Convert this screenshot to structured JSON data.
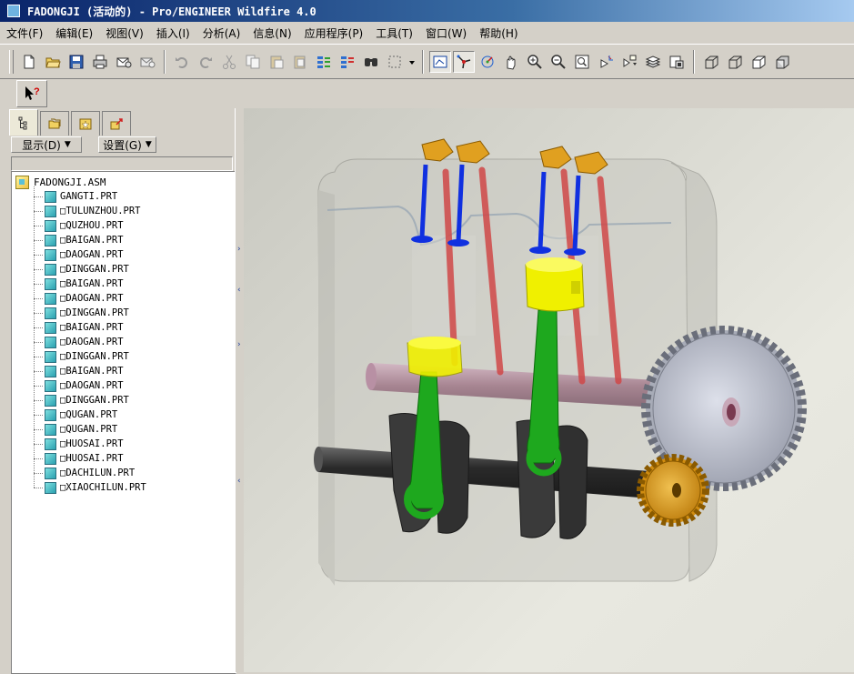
{
  "window": {
    "title": "FADONGJI (活动的) - Pro/ENGINEER Wildfire 4.0"
  },
  "menubar": {
    "items": [
      "文件(F)",
      "编辑(E)",
      "视图(V)",
      "插入(I)",
      "分析(A)",
      "信息(N)",
      "应用程序(P)",
      "工具(T)",
      "窗口(W)",
      "帮助(H)"
    ]
  },
  "toolbar": {
    "icons": [
      "new-icon",
      "open-icon",
      "save-icon",
      "print-icon",
      "email-icon",
      "email-link-icon",
      "undo-icon",
      "redo-icon",
      "cut-icon",
      "copy-icon",
      "paste-icon",
      "paste-special-icon",
      "regenerate-icon",
      "regen-manager-icon",
      "find-icon",
      "select-box-icon",
      "repaint-icon",
      "spin-center-icon",
      "orient-mode-icon",
      "pan-hand-icon",
      "zoom-in-icon",
      "zoom-out-icon",
      "refit-icon",
      "reorient-icon",
      "saved-views-icon",
      "layers-icon",
      "view-manager-icon",
      "wireframe-icon",
      "hidden-line-icon",
      "no-hidden-icon",
      "shading-icon"
    ]
  },
  "toolbar2": {
    "icons": [
      "context-help-icon"
    ]
  },
  "navigator": {
    "tabs": [
      "model-tree-tab",
      "folder-browser-tab",
      "favorites-tab",
      "connections-tab"
    ],
    "show_label": "显示(D)",
    "settings_label": "设置(G)",
    "root": "FADONGJI.ASM",
    "items": [
      "GANGTI.PRT",
      "□TULUNZHOU.PRT",
      "□QUZHOU.PRT",
      "□BAIGAN.PRT",
      "□DAOGAN.PRT",
      "□DINGGAN.PRT",
      "□BAIGAN.PRT",
      "□DAOGAN.PRT",
      "□DINGGAN.PRT",
      "□BAIGAN.PRT",
      "□DAOGAN.PRT",
      "□DINGGAN.PRT",
      "□BAIGAN.PRT",
      "□DAOGAN.PRT",
      "□DINGGAN.PRT",
      "□QUGAN.PRT",
      "□QUGAN.PRT",
      "□HUOSAI.PRT",
      "□HUOSAI.PRT",
      "□DACHILUN.PRT",
      "□XIAOCHILUN.PRT"
    ]
  },
  "colors": {
    "titlebar": "#0a246a",
    "connecting_rod": "#1ea81e",
    "piston": "#f0f000",
    "valve_stem_blue": "#1030e0",
    "pushrod_red": "#d04040",
    "rocker": "#e0a020",
    "small_gear": "#e0a020",
    "big_gear": "#b8bcc8",
    "crank": "#3a3a3a",
    "camshaft": "#b88aa0"
  }
}
